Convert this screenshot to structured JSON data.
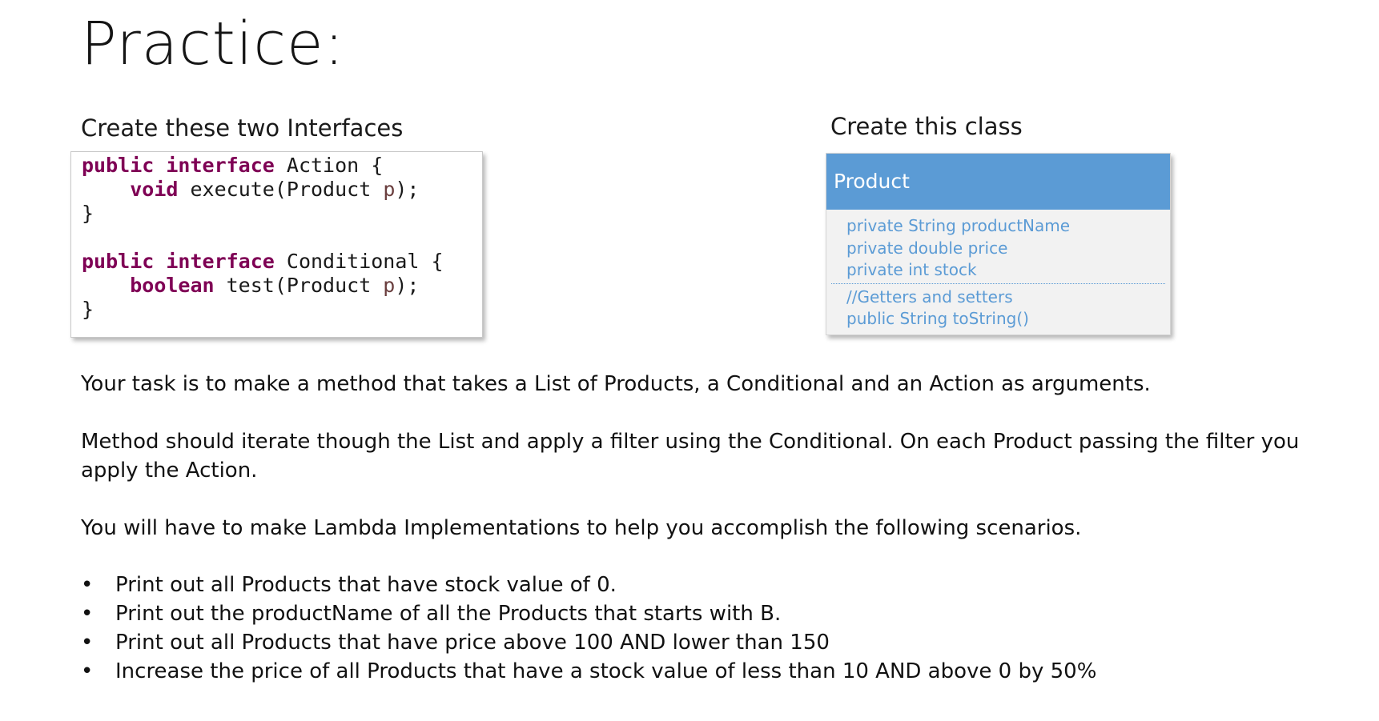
{
  "slide": {
    "title": "Practice:"
  },
  "interfaces_section": {
    "heading": "Create these two Interfaces",
    "code": {
      "line1": {
        "kw1": "public",
        "kw2": "interface",
        "rest": " Action {"
      },
      "line2": {
        "indent": "    ",
        "kw": "void",
        "rest": " execute(Product ",
        "param": "p",
        "end": ");"
      },
      "line3": "}",
      "line5": {
        "kw1": "public",
        "kw2": "interface",
        "rest": " Conditional {"
      },
      "line6": {
        "indent": "    ",
        "kw": "boolean",
        "rest": " test(Product ",
        "param": "p",
        "end": ");"
      },
      "line7": "}"
    }
  },
  "class_section": {
    "heading": "Create this class",
    "uml": {
      "class_name": "Product",
      "fields": [
        "private String productName",
        "private double price",
        "private int stock"
      ],
      "methods": [
        "//Getters and setters",
        "public String toString()"
      ],
      "header_color": "#5b9bd5",
      "text_color": "#5b9bd5"
    }
  },
  "task": {
    "paragraph1": "Your task is to make a method that takes a List of Products, a Conditional and an Action as arguments.",
    "paragraph2": "Method should iterate though the List and apply a filter using the Conditional. On each Product passing the filter you apply the Action.",
    "paragraph3": "You will have to make Lambda Implementations to help you accomplish the following scenarios.",
    "bullet_symbol": "•",
    "scenarios": [
      "Print out all Products that have stock value of 0.",
      "Print out the productName of all the Products that starts with B.",
      "Print out all Products that have price above 100 AND lower than 150",
      "Increase the price of all Products that have a stock value of less than 10 AND above 0 by 50%"
    ]
  },
  "colors": {
    "keyword": "#7f0055",
    "parameter": "#6a3e3e"
  }
}
